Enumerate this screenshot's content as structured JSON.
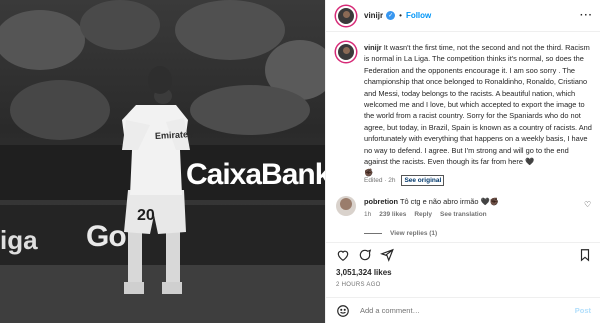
{
  "photo": {
    "sponsor_text": "CaixaBank",
    "ad_text": "Go",
    "side_text": "iga",
    "shirt_sponsor": "Emirates",
    "shirt_number": "20"
  },
  "post": {
    "username": "vinijr",
    "verified_icon": "verified-badge-icon",
    "follow_label": "Follow",
    "more_icon": "more-options-icon",
    "caption": "It wasn't the first time, not the second and not the third. Racism is normal in La Liga. The competition thinks it's normal, so does the Federation and the opponents encourage it. I am soo sorry . The championship that once belonged to Ronaldinho, Ronaldo, Cristiano and Messi, today belongs to the racists. A beautiful nation, which welcomed me and I love, but which accepted to export the image to the world from a racist country. Sorry for the Spaniards who do not agree, but today, in Brazil, Spain is known as a country of racists. And unfortunately with everything that happens on a weekly basis, I have no way to defend. I agree. But I'm strong and will go to the end against the racists. Even though its far from here 🖤",
    "caption_trailing_emoji": "✊🏿",
    "edited_label": "Edited · 2h",
    "see_original_label": "See original"
  },
  "comments": [
    {
      "username": "pobretion",
      "text": "Tô ctg e não abro irmão 🖤✊🏿",
      "time": "1h",
      "likes": "239 likes",
      "reply_label": "Reply",
      "translate_label": "See translation"
    }
  ],
  "view_replies_label": "View replies (1)",
  "actions": {
    "like_icon": "heart-icon",
    "comment_icon": "comment-icon",
    "share_icon": "share-icon",
    "save_icon": "bookmark-icon"
  },
  "likes_count": "3,051,324 likes",
  "time_ago": "2 HOURS AGO",
  "add_comment": {
    "placeholder": "Add a comment…",
    "post_label": "Post"
  }
}
